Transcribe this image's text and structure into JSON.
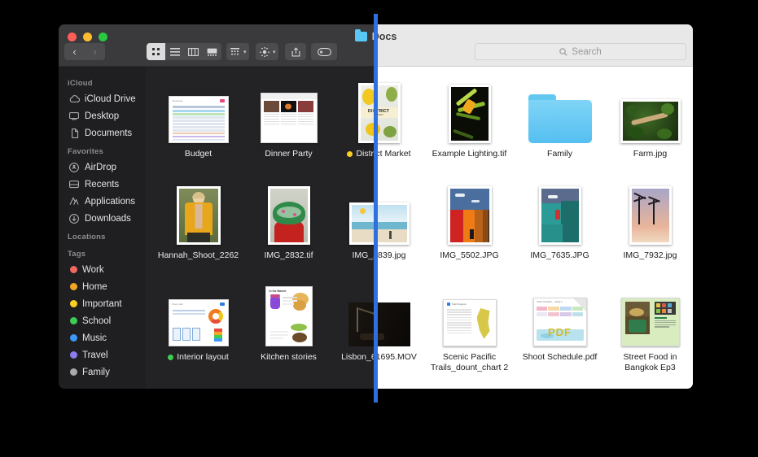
{
  "window": {
    "title": "Docs",
    "title_folder_icon": "folder-icon",
    "traffic_lights": [
      "close-button",
      "minimize-button",
      "zoom-button"
    ]
  },
  "toolbar": {
    "back_label": "‹",
    "forward_label": "›",
    "view_modes": [
      {
        "name": "icon-view",
        "glyph": "∷",
        "active": true
      },
      {
        "name": "list-view",
        "glyph": "≡",
        "active": false
      },
      {
        "name": "column-view",
        "glyph": "⦀",
        "active": false
      },
      {
        "name": "gallery-view",
        "glyph": "▤",
        "active": false
      }
    ],
    "group_by_label": "group-by-icon",
    "action_label": "gear-icon",
    "share_label": "share-icon",
    "tags_label": "tag-icon",
    "chevron": "▾"
  },
  "search": {
    "placeholder": "Search",
    "value": "",
    "icon": "search-icon"
  },
  "sidebar": {
    "sections": [
      {
        "header": "iCloud",
        "items": [
          {
            "label": "iCloud Drive",
            "icon": "☁"
          },
          {
            "label": "Desktop",
            "icon": "▤"
          },
          {
            "label": "Documents",
            "icon": "⎘"
          }
        ]
      },
      {
        "header": "Favorites",
        "items": [
          {
            "label": "AirDrop",
            "icon": "◎"
          },
          {
            "label": "Recents",
            "icon": "⏱"
          },
          {
            "label": "Applications",
            "icon": "✦"
          },
          {
            "label": "Downloads",
            "icon": "⬇"
          }
        ]
      },
      {
        "header": "Locations",
        "items": []
      },
      {
        "header": "Tags",
        "items": [
          {
            "label": "Work",
            "color": "#f1675f"
          },
          {
            "label": "Home",
            "color": "#f5a623"
          },
          {
            "label": "Important",
            "color": "#fbd024"
          },
          {
            "label": "School",
            "color": "#3fcc53"
          },
          {
            "label": "Music",
            "color": "#3b9af8"
          },
          {
            "label": "Travel",
            "color": "#8a7cf0"
          },
          {
            "label": "Family",
            "color": "#a8a8ad"
          }
        ]
      }
    ]
  },
  "files": [
    {
      "name": "Budget",
      "kind": "spreadsheet",
      "tag": null
    },
    {
      "name": "Dinner Party",
      "kind": "document",
      "tag": null
    },
    {
      "name": "District Market",
      "kind": "poster",
      "tag": "#fbd024"
    },
    {
      "name": "Example Lighting.tif",
      "kind": "photo",
      "tag": null
    },
    {
      "name": "Family",
      "kind": "folder",
      "tag": null
    },
    {
      "name": "Farm.jpg",
      "kind": "photo",
      "tag": null
    },
    {
      "name": "Hannah_Shoot_2262",
      "kind": "photo",
      "tag": null
    },
    {
      "name": "IMG_2832.tif",
      "kind": "photo",
      "tag": null
    },
    {
      "name": "IMG_2839.jpg",
      "kind": "photo",
      "tag": null
    },
    {
      "name": "IMG_5502.JPG",
      "kind": "photo",
      "tag": null
    },
    {
      "name": "IMG_7635.JPG",
      "kind": "photo",
      "tag": null
    },
    {
      "name": "IMG_7932.jpg",
      "kind": "photo",
      "tag": null
    },
    {
      "name": "Interior layout",
      "kind": "document",
      "tag": "#3fcc53"
    },
    {
      "name": "Kitchen stories",
      "kind": "document",
      "tag": null
    },
    {
      "name": "Lisbon_61695.MOV",
      "kind": "movie",
      "tag": null
    },
    {
      "name": "Scenic Pacific Trails_dount_chart 2",
      "kind": "document",
      "tag": null
    },
    {
      "name": "Shoot Schedule.pdf",
      "kind": "pdf",
      "tag": null
    },
    {
      "name": "Street Food in Bangkok Ep3",
      "kind": "document",
      "tag": null
    }
  ],
  "guide_line": {
    "color": "#2f6fe0",
    "name": "theme-split-divider"
  }
}
